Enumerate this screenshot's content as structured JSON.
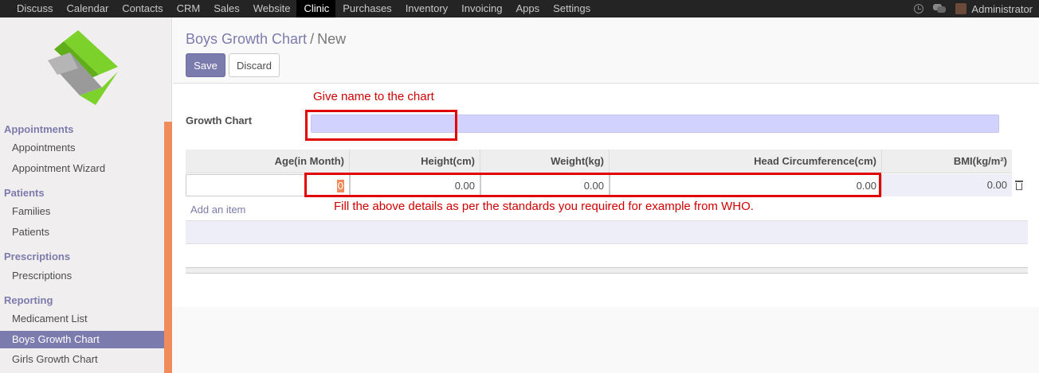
{
  "topnav": [
    "Discuss",
    "Calendar",
    "Contacts",
    "CRM",
    "Sales",
    "Website",
    "Clinic",
    "Purchases",
    "Inventory",
    "Invoicing",
    "Apps",
    "Settings"
  ],
  "active_topnav": "Clinic",
  "user": {
    "name": "Administrator"
  },
  "sidebar": {
    "sections": [
      {
        "title": "Appointments",
        "items": [
          "Appointments",
          "Appointment Wizard"
        ]
      },
      {
        "title": "Patients",
        "items": [
          "Families",
          "Patients"
        ]
      },
      {
        "title": "Prescriptions",
        "items": [
          "Prescriptions"
        ]
      },
      {
        "title": "Reporting",
        "items": [
          "Medicament List",
          "Boys Growth Chart",
          "Girls Growth Chart"
        ]
      }
    ],
    "active_item": "Boys Growth Chart"
  },
  "breadcrumb": {
    "parent": "Boys Growth Chart",
    "separator": "/",
    "current": "New"
  },
  "buttons": {
    "save": "Save",
    "discard": "Discard"
  },
  "annotations": {
    "name_hint": "Give name to the chart",
    "details_hint": "Fill the above details as per the standards you required for example from WHO."
  },
  "form": {
    "growth_chart_label": "Growth Chart",
    "growth_chart_value": ""
  },
  "table": {
    "columns": [
      "Age(in Month)",
      "Height(cm)",
      "Weight(kg)",
      "Head Circumference(cm)",
      "BMI(kg/m²)"
    ],
    "row": {
      "age": "0",
      "height": "0.00",
      "weight": "0.00",
      "head": "0.00",
      "bmi": "0.00"
    },
    "add_item": "Add an item"
  },
  "colors": {
    "accent": "#7c7bad",
    "annotation": "#e30000",
    "topbar": "#242424",
    "sidebar_strip": "#f08c5c"
  }
}
